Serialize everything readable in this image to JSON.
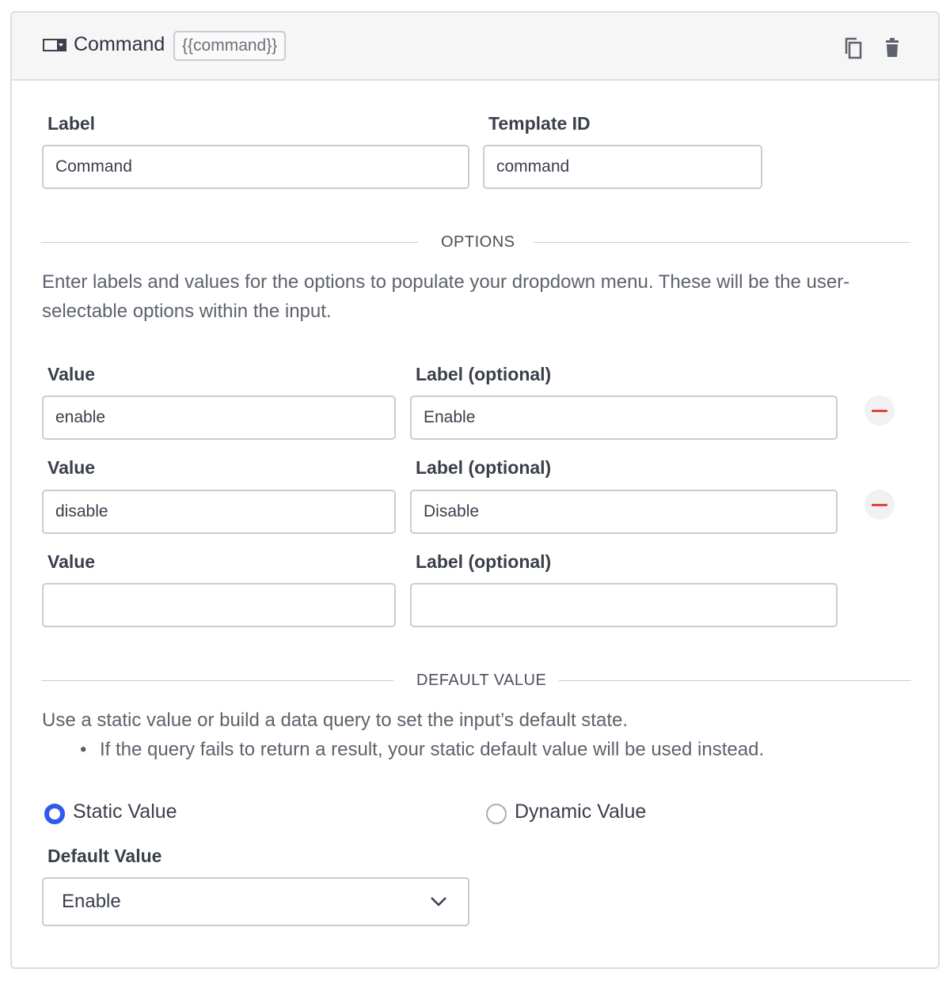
{
  "header": {
    "title": "Command",
    "badge": "{{command}}"
  },
  "fields": {
    "label": {
      "label": "Label",
      "value": "Command"
    },
    "template_id": {
      "label": "Template ID",
      "value": "command"
    }
  },
  "options_section": {
    "title": "OPTIONS",
    "help": "Enter labels and values for the options to populate your dropdown menu. These will be the user-selectable options within the input.",
    "rows": [
      {
        "value_label": "Value",
        "label_label": "Label (optional)",
        "value": "enable",
        "label": "Enable"
      },
      {
        "value_label": "Value",
        "label_label": "Label (optional)",
        "value": "disable",
        "label": "Disable"
      },
      {
        "value_label": "Value",
        "label_label": "Label (optional)",
        "value": "",
        "label": ""
      }
    ]
  },
  "default_section": {
    "title": "DEFAULT VALUE",
    "help": "Use a static value or build a data query to set the input’s default state.",
    "bullet": "If the query fails to return a result, your static default value will be used instead.",
    "radio_static": "Static Value",
    "radio_dynamic": "Dynamic Value",
    "selected": "static",
    "default_label": "Default Value",
    "default_value": "Enable"
  },
  "colors": {
    "accent": "#2f5bea",
    "remove": "#e0443c"
  },
  "icons": {
    "header": "dropdown-input-icon",
    "copy": "copy-icon",
    "delete": "trash-icon",
    "remove": "minus-icon",
    "select": "chevron-down-icon"
  }
}
